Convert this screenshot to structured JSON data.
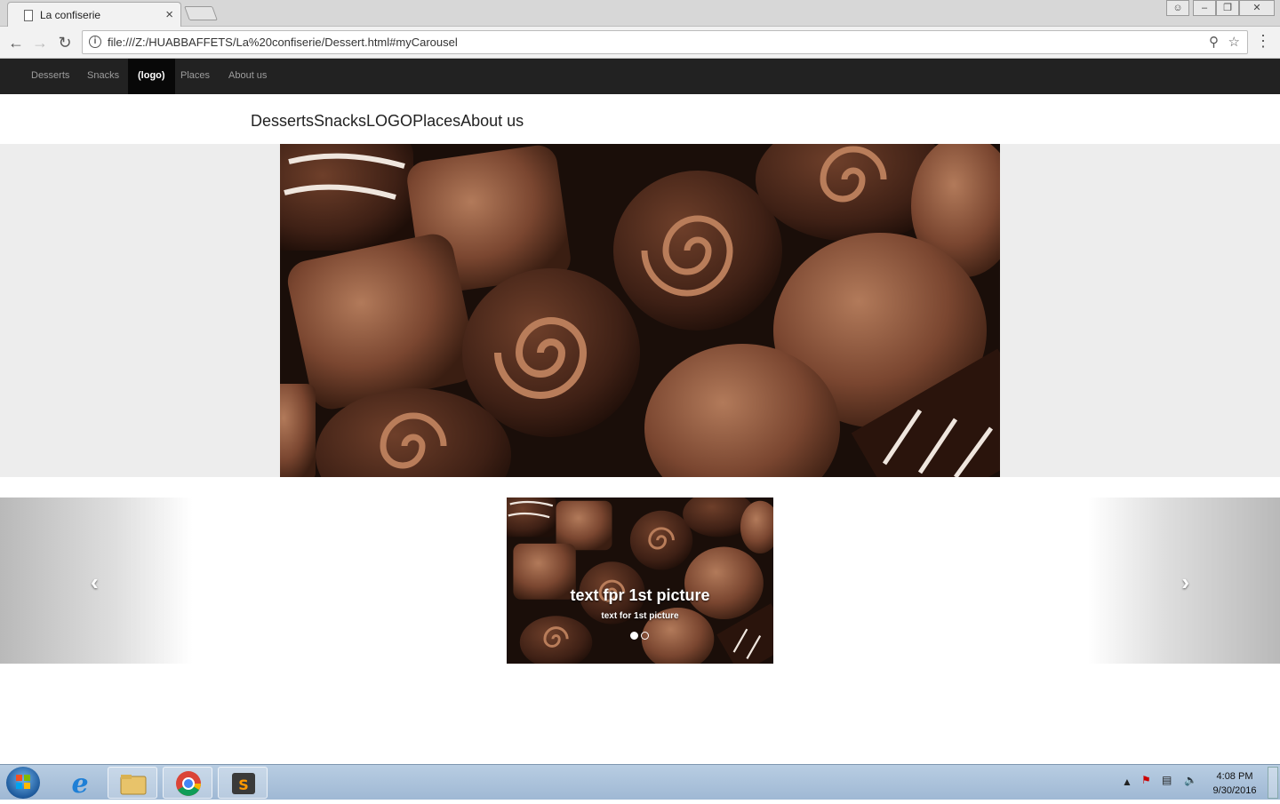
{
  "browser": {
    "tab_title": "La confiserie",
    "tab_close": "×",
    "url": "file:///Z:/HUABBAFFETS/La%20confiserie/Dessert.html#myCarousel",
    "back_icon": "arrow-left",
    "forward_icon": "arrow-right",
    "reload_icon": "reload",
    "info_icon": "i"
  },
  "navbar": {
    "items": [
      {
        "label": "Desserts"
      },
      {
        "label": "Snacks"
      },
      {
        "label": "(logo)"
      },
      {
        "label": "Places"
      },
      {
        "label": "About us"
      }
    ]
  },
  "plain_links": [
    "Desserts",
    "Snacks",
    "LOGO",
    "Places",
    "About us"
  ],
  "carousel": {
    "prev": "‹",
    "next": "›",
    "caption_title": "text fpr 1st picture",
    "caption_text": "text for 1st picture",
    "active_index": 0,
    "slide_count": 2
  },
  "taskbar": {
    "time": "4:08 PM",
    "date": "9/30/2016",
    "apps": [
      "internet-explorer",
      "file-explorer",
      "chrome",
      "sublime-text"
    ]
  },
  "colors": {
    "navbar_bg": "#222222",
    "navbar_active_bg": "#080808",
    "band_bg": "#ededed"
  }
}
